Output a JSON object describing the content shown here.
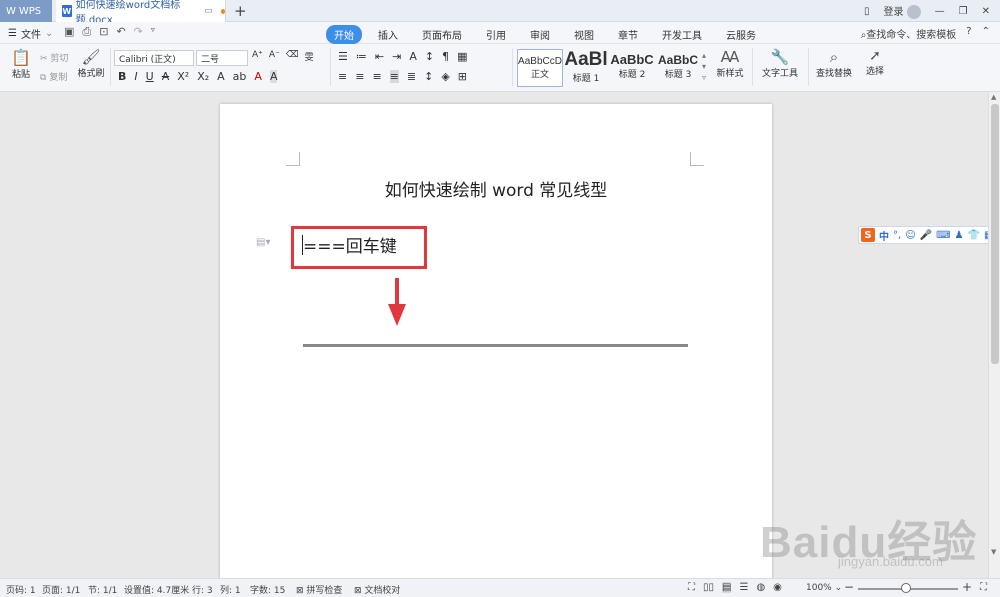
{
  "titlebar": {
    "app_tab": "WPS",
    "doc_tab": "如何快速绘word文档标题.docx",
    "new_tab": "+",
    "login": "登录"
  },
  "menubar": {
    "file": "文件",
    "tabs": [
      "开始",
      "插入",
      "页面布局",
      "引用",
      "审阅",
      "视图",
      "章节",
      "开发工具",
      "云服务"
    ],
    "search": "查找命令、搜索模板",
    "help": "?"
  },
  "ribbon": {
    "paste": "粘贴",
    "cut": "剪切",
    "copy": "复制",
    "format_painter": "格式刷",
    "font_name": "Calibri (正文)",
    "font_size": "二号",
    "styles": [
      {
        "sample": "AaBbCcD",
        "label": "正文"
      },
      {
        "sample": "AaBl",
        "label": "标题 1"
      },
      {
        "sample": "AaBbC",
        "label": "标题 2"
      },
      {
        "sample": "AaBbC",
        "label": "标题 3"
      }
    ],
    "new_style": "新样式",
    "text_tools": "文字工具",
    "find_replace": "查找替换",
    "select": "选择"
  },
  "document": {
    "title": "如何快速绘制 word 常见线型",
    "line_text": "===回车键"
  },
  "ime": {
    "logo": "S",
    "mode": "中"
  },
  "statusbar": {
    "page_no": "页码: 1",
    "pages": "页面: 1/1",
    "section": "节: 1/1",
    "setting": "设置值: 4.7厘米",
    "row": "行: 3",
    "col": "列: 1",
    "words": "字数: 15",
    "spell": "拼写检查",
    "proof": "文档校对",
    "zoom": "100%",
    "zoom_level": 0.5
  },
  "watermark": {
    "brand": "Baidu经验",
    "url": "jingyan.baidu.com"
  },
  "colors": {
    "accent": "#3c8ee6",
    "highlight_box": "#e0383e",
    "arrow": "#e0383e",
    "rule_line": "#888888"
  }
}
